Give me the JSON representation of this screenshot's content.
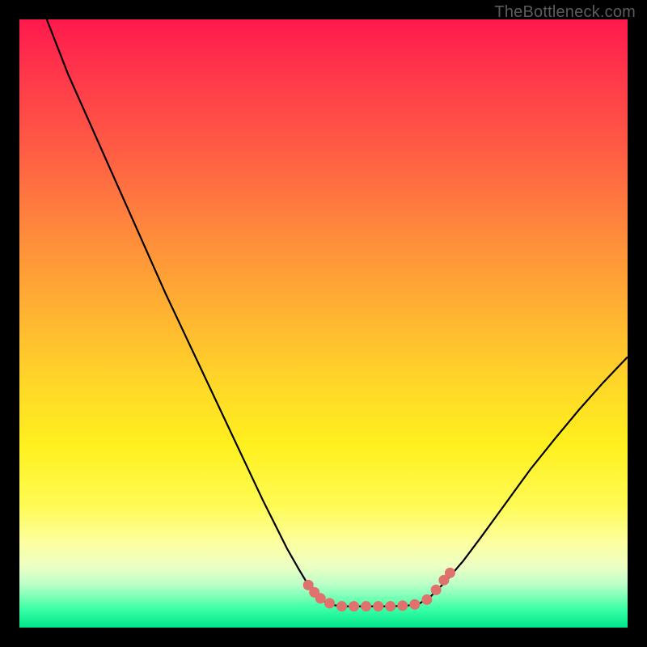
{
  "attribution": "TheBottleneck.com",
  "colors": {
    "frame": "#000000",
    "curve": "#000000",
    "marker": "#e0716c"
  },
  "chart_data": {
    "type": "line",
    "title": "",
    "xlabel": "",
    "ylabel": "",
    "xlim": [
      0,
      100
    ],
    "ylim": [
      0,
      100
    ],
    "series": [
      {
        "name": "left-branch",
        "x": [
          4.5,
          8,
          12,
          16,
          20,
          24,
          28,
          32,
          36,
          40,
          42,
          44,
          46,
          47.5,
          49,
          51,
          53
        ],
        "y": [
          100,
          91,
          82,
          73,
          64,
          55,
          46.5,
          38,
          29.5,
          21,
          17,
          13,
          9.5,
          7,
          5,
          3.8,
          3.5
        ]
      },
      {
        "name": "flat-bottom",
        "x": [
          53,
          55,
          58,
          61,
          63.5,
          65.5
        ],
        "y": [
          3.5,
          3.5,
          3.5,
          3.5,
          3.6,
          3.8
        ]
      },
      {
        "name": "right-branch",
        "x": [
          65.5,
          67.5,
          70,
          73,
          76,
          80,
          84,
          88,
          92,
          96,
          100
        ],
        "y": [
          3.8,
          5,
          7.5,
          11,
          15,
          20.5,
          26,
          31,
          35.8,
          40.3,
          44.5
        ]
      }
    ],
    "markers": {
      "name": "bottom-dots",
      "points": [
        {
          "x": 47.5,
          "y": 7.0
        },
        {
          "x": 48.5,
          "y": 5.8
        },
        {
          "x": 49.5,
          "y": 4.8
        },
        {
          "x": 51.0,
          "y": 4.0
        },
        {
          "x": 53.0,
          "y": 3.5
        },
        {
          "x": 55.0,
          "y": 3.5
        },
        {
          "x": 57.0,
          "y": 3.5
        },
        {
          "x": 59.0,
          "y": 3.5
        },
        {
          "x": 61.0,
          "y": 3.5
        },
        {
          "x": 63.0,
          "y": 3.6
        },
        {
          "x": 65.0,
          "y": 3.8
        },
        {
          "x": 67.0,
          "y": 4.6
        },
        {
          "x": 68.5,
          "y": 6.2
        },
        {
          "x": 69.8,
          "y": 7.8
        },
        {
          "x": 70.8,
          "y": 9.0
        }
      ]
    }
  }
}
